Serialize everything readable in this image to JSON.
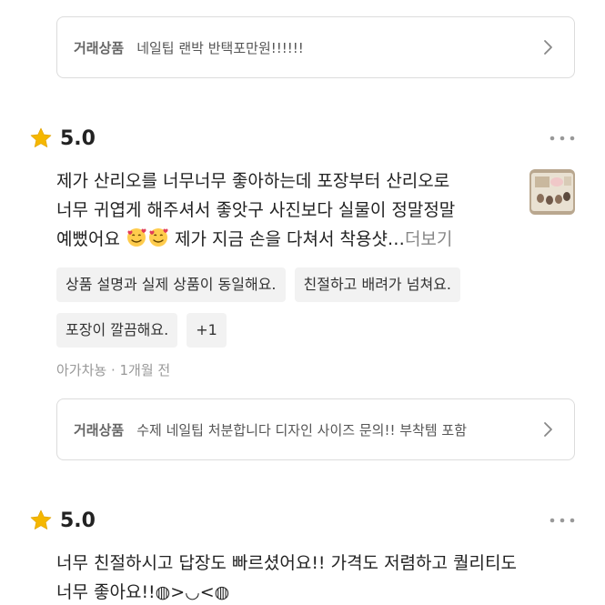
{
  "trade_label": "거래상품",
  "review1_top_trade": {
    "title": "네일팁 랜박 반택포만원!!!!!!"
  },
  "review1": {
    "score": "5.0",
    "text_line1": "제가 산리오를 너무너무 좋아하는데 포장부터 산리오로",
    "text_line2": "너무 귀엽게 해주셔서 좋앗구 사진보다 실물이 정말정말",
    "text_line3_a": "예뻤어요 ",
    "text_line3_b": " 제가 지금 손을 다쳐서 착용샷…",
    "more_label": "더보기",
    "tags": [
      "상품 설명과 실제 상품이 동일해요.",
      "친절하고 배려가 넘쳐요.",
      "포장이 깔끔해요.",
      "+1"
    ],
    "author": "아가차뇽",
    "separator": " · ",
    "time": "1개월 전",
    "trade_title": "수제 네일팁 처분합니다 디자인 사이즈 문의!! 부착템 포함"
  },
  "review2": {
    "score": "5.0",
    "text_line1": "너무 친절하시고 답장도 빠르셨어요!! 가격도 저렴하고 퀄리티도",
    "text_line2": "너무 좋아요!!◍>◡<◍"
  },
  "colors": {
    "star": "#f5b700",
    "border": "#dcdcdc",
    "tag_bg": "#f2f2f2",
    "muted_text": "#999999"
  },
  "icons": {
    "star": "star-icon",
    "more": "more-dots-icon",
    "chevron": "chevron-right-icon",
    "emoji": "smiling-face-with-hearts-icon"
  }
}
